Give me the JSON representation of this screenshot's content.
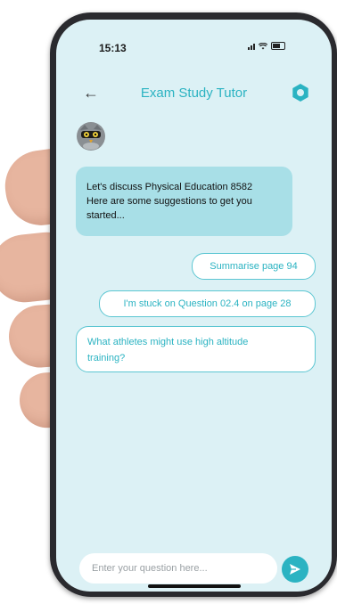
{
  "status_bar": {
    "time": "15:13"
  },
  "header": {
    "back_icon": "back-arrow-icon",
    "title": "Exam Study Tutor",
    "settings_icon": "hexagon-icon"
  },
  "messages": [
    {
      "from": "bot",
      "lines": [
        "Let's discuss Physical Education 8582",
        "Here are some suggestions to get you",
        "started..."
      ]
    }
  ],
  "suggestions": [
    {
      "label": "Summarise page 94"
    },
    {
      "label": "I'm stuck on Question 02.4 on page 28"
    },
    {
      "lines": [
        "What athletes might use high altitude",
        "training?"
      ]
    }
  ],
  "composer": {
    "placeholder": "Enter your question here...",
    "send_icon": "send-icon"
  },
  "colors": {
    "accent": "#2bb3c2",
    "screen_bg": "#dcf1f5",
    "bot_bubble": "#a8dfe7",
    "phone_frame": "#2a2a2e"
  }
}
